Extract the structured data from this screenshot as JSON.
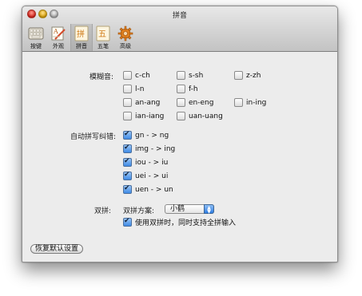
{
  "window": {
    "title": "拼音"
  },
  "toolbar": {
    "items": [
      {
        "label": "按键",
        "icon": "keyboard-icon"
      },
      {
        "label": "外观",
        "icon": "appearance-icon"
      },
      {
        "label": "拼音",
        "icon": "pinyin-icon",
        "selected": true
      },
      {
        "label": "五笔",
        "icon": "wubi-icon"
      },
      {
        "label": "高级",
        "icon": "gear-icon"
      }
    ]
  },
  "fuzzy": {
    "label": "模糊音:",
    "options": [
      {
        "label": "c-ch",
        "checked": false
      },
      {
        "label": "s-sh",
        "checked": false
      },
      {
        "label": "z-zh",
        "checked": false
      },
      {
        "label": "l-n",
        "checked": false
      },
      {
        "label": "f-h",
        "checked": false
      },
      {
        "label": "an-ang",
        "checked": false
      },
      {
        "label": "en-eng",
        "checked": false
      },
      {
        "label": "in-ing",
        "checked": false
      },
      {
        "label": "ian-iang",
        "checked": false
      },
      {
        "label": "uan-uang",
        "checked": false
      }
    ]
  },
  "autocorrect": {
    "label": "自动拼写纠错:",
    "options": [
      {
        "label": "gn - > ng",
        "checked": true
      },
      {
        "label": "img - > ing",
        "checked": true
      },
      {
        "label": "iou - > iu",
        "checked": true
      },
      {
        "label": "uei - > ui",
        "checked": true
      },
      {
        "label": "uen - > un",
        "checked": true
      }
    ]
  },
  "shuangpin": {
    "label": "双拼:",
    "scheme_label": "双拼方案:",
    "scheme_value": "小鹤",
    "support_full_label": "使用双拼时，同时支持全拼输入",
    "support_full_checked": true
  },
  "reset_button": "恢复默认设置",
  "colors": {
    "accent": "#3e8ae6",
    "window_bg": "#ececec",
    "toolbar_bg": "#c9c9c9"
  }
}
